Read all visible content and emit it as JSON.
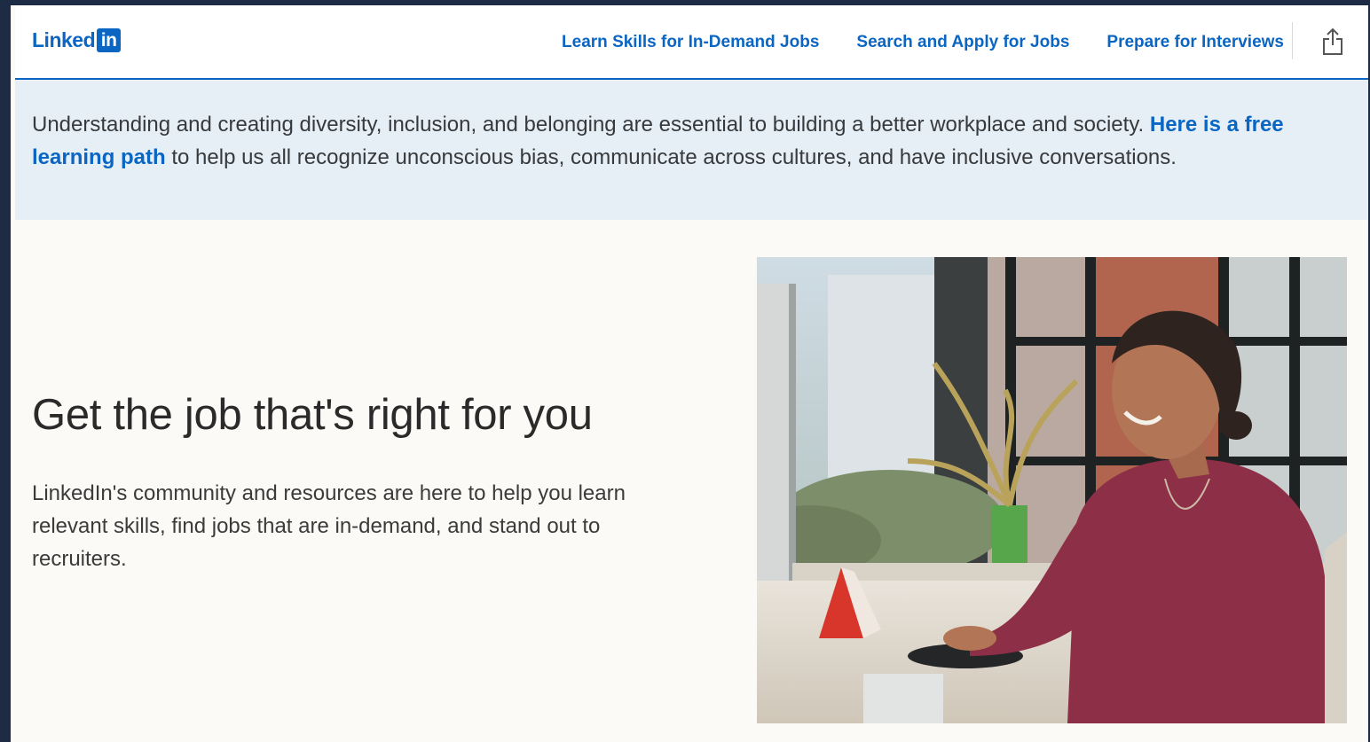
{
  "header": {
    "logo_text": "Linked",
    "logo_badge": "in",
    "nav": [
      {
        "label": "Learn Skills for In-Demand Jobs"
      },
      {
        "label": "Search and Apply for Jobs"
      },
      {
        "label": "Prepare for Interviews"
      }
    ],
    "share_icon": "share-icon"
  },
  "banner": {
    "text_before": "Understanding and creating diversity, inclusion, and belonging are essential to building a better workplace and society. ",
    "link_text": "Here is a free learning path",
    "text_after": " to help us all recognize unconscious bias, communicate across cultures, and have inclusive conversations."
  },
  "hero": {
    "title": "Get the job that's right for you",
    "description": "LinkedIn's community and resources are here to help you learn relevant skills, find jobs that are in-demand, and stand out to recruiters."
  },
  "colors": {
    "brand_blue": "#0a66c2",
    "banner_bg": "#e6eef6",
    "page_bg": "#fcfaf7",
    "outer_bg": "#1d2b45"
  }
}
